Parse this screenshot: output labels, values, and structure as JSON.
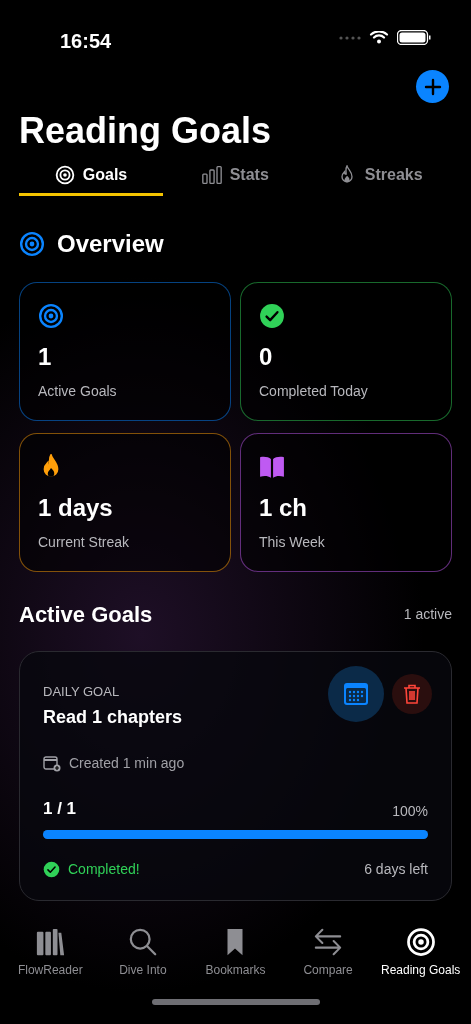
{
  "status_bar": {
    "time": "16:54"
  },
  "header": {
    "title": "Reading Goals"
  },
  "tabs": [
    {
      "label": "Goals",
      "kind": "target",
      "selected": true
    },
    {
      "label": "Stats",
      "kind": "bars",
      "selected": false
    },
    {
      "label": "Streaks",
      "kind": "flame",
      "selected": false
    }
  ],
  "overview": {
    "title": "Overview",
    "cards": [
      {
        "kind": "target",
        "value": "1",
        "label": "Active Goals",
        "color": "#0a84ff"
      },
      {
        "kind": "check",
        "value": "0",
        "label": "Completed Today",
        "color": "#30d158"
      },
      {
        "kind": "flame",
        "value": "1 days",
        "label": "Current Streak",
        "color": "#ff9f0a"
      },
      {
        "kind": "book",
        "value": "1 ch",
        "label": "This Week",
        "color": "#bf5af2"
      }
    ]
  },
  "active_goals": {
    "title": "Active Goals",
    "count": "1 active",
    "goals": [
      {
        "period": "DAILY GOAL",
        "title": "Read 1 chapters",
        "created": "Created 1 min ago",
        "progress": "1 / 1",
        "percent": "100%",
        "level": 1,
        "completed": true,
        "status": "Completed!",
        "remaining": "6 days left"
      }
    ]
  },
  "tab_bar": [
    {
      "label": "FlowReader",
      "kind": "books",
      "selected": false
    },
    {
      "label": "Dive Into",
      "kind": "search",
      "selected": false
    },
    {
      "label": "Bookmarks",
      "kind": "bookmark",
      "selected": false
    },
    {
      "label": "Compare",
      "kind": "arrows",
      "selected": false
    },
    {
      "label": "Reading Goals",
      "kind": "target",
      "selected": true
    }
  ]
}
